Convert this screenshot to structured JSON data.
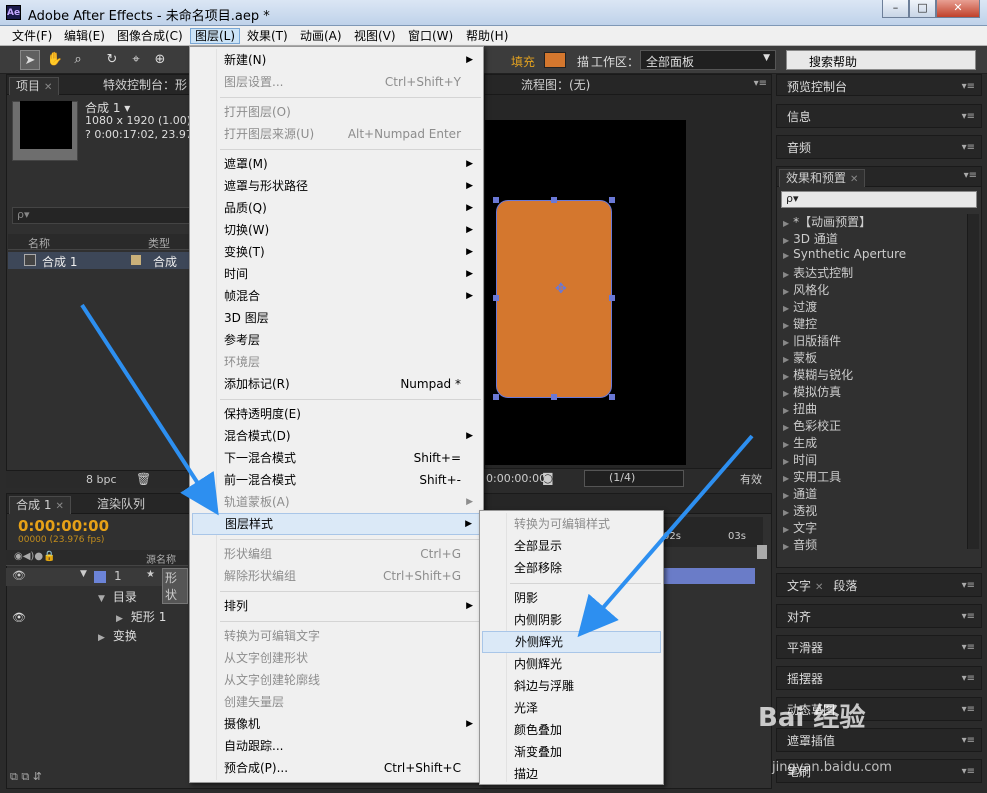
{
  "window": {
    "app_badge": "Ae",
    "title": "Adobe After Effects - 未命名项目.aep *",
    "min": "–",
    "max": "□",
    "close": "✕"
  },
  "menubar": [
    "文件(F)",
    "编辑(E)",
    "图像合成(C)",
    "图层(L)",
    "效果(T)",
    "动画(A)",
    "视图(V)",
    "窗口(W)",
    "帮助(H)"
  ],
  "toolbar": {
    "fill": "填充",
    "stroke": "描",
    "workspace_label": "工作区：",
    "workspace_value": "全部面板",
    "search_help": "搜索帮助"
  },
  "project_panel": {
    "tab": "项目",
    "tab2": "特效控制台：形",
    "comp_name": "合成 1 ▾",
    "comp_size": "1080 x 1920 (1.00)",
    "comp_dur": "? 0:00:17:02, 23.976",
    "search_placeholder": "ρ▾",
    "col_name": "名称",
    "col_type": "类型",
    "row_name": "合成 1",
    "row_type": "合成",
    "bpc": "8 bpc"
  },
  "viewer": {
    "flow_tab": "流程图：(无)",
    "timecode": "0:00:00:00",
    "res": "(1/4)",
    "active": "有效"
  },
  "layer_menu": [
    {
      "label": "新建(N)",
      "sub": true
    },
    {
      "label": "图层设置...",
      "sc": "Ctrl+Shift+Y",
      "dis": true
    },
    {
      "sep": true
    },
    {
      "label": "打开图层(O)",
      "dis": true
    },
    {
      "label": "打开图层来源(U)",
      "sc": "Alt+Numpad Enter",
      "dis": true
    },
    {
      "sep": true
    },
    {
      "label": "遮罩(M)",
      "sub": true
    },
    {
      "label": "遮罩与形状路径",
      "sub": true
    },
    {
      "label": "品质(Q)",
      "sub": true
    },
    {
      "label": "切换(W)",
      "sub": true
    },
    {
      "label": "变换(T)",
      "sub": true
    },
    {
      "label": "时间",
      "sub": true
    },
    {
      "label": "帧混合",
      "sub": true
    },
    {
      "label": "3D 图层"
    },
    {
      "label": "参考层"
    },
    {
      "label": "环境层",
      "dis": true
    },
    {
      "label": "添加标记(R)",
      "sc": "Numpad *"
    },
    {
      "sep": true
    },
    {
      "label": "保持透明度(E)"
    },
    {
      "label": "混合模式(D)",
      "sub": true
    },
    {
      "label": "下一混合模式",
      "sc": "Shift+="
    },
    {
      "label": "前一混合模式",
      "sc": "Shift+-"
    },
    {
      "label": "轨道蒙板(A)",
      "sub": true,
      "dis": true
    },
    {
      "label": "图层样式",
      "sub": true,
      "hl": true
    },
    {
      "sep": true
    },
    {
      "label": "形状编组",
      "sc": "Ctrl+G",
      "dis": true
    },
    {
      "label": "解除形状编组",
      "sc": "Ctrl+Shift+G",
      "dis": true
    },
    {
      "sep": true
    },
    {
      "label": "排列",
      "sub": true
    },
    {
      "sep": true
    },
    {
      "label": "转换为可编辑文字",
      "dis": true
    },
    {
      "label": "从文字创建形状",
      "dis": true
    },
    {
      "label": "从文字创建轮廓线",
      "dis": true
    },
    {
      "label": "创建矢量层",
      "dis": true
    },
    {
      "label": "摄像机",
      "sub": true
    },
    {
      "label": "自动跟踪..."
    },
    {
      "label": "预合成(P)...",
      "sc": "Ctrl+Shift+C"
    }
  ],
  "style_menu": [
    {
      "label": "转换为可编辑样式",
      "dis": true
    },
    {
      "label": "全部显示"
    },
    {
      "label": "全部移除"
    },
    {
      "sep": true
    },
    {
      "label": "阴影"
    },
    {
      "label": "内侧阴影"
    },
    {
      "label": "外侧辉光",
      "hl": true
    },
    {
      "label": "内侧辉光"
    },
    {
      "label": "斜边与浮雕"
    },
    {
      "label": "光泽"
    },
    {
      "label": "颜色叠加"
    },
    {
      "label": "渐变叠加"
    },
    {
      "label": "描边"
    }
  ],
  "right_panels": {
    "preview": "预览控制台",
    "info": "信息",
    "audio": "音频",
    "effects": "效果和预置",
    "text": "文字",
    "paragraph": "段落",
    "align": "对齐",
    "smoother": "平滑器",
    "wiggler": "摇摆器",
    "motion": "动态草图",
    "mask": "遮罩插值",
    "brush": "笔刷"
  },
  "effects_list": [
    "*【动画预置】",
    "3D 通道",
    "Synthetic Aperture",
    "表达式控制",
    "风格化",
    "过渡",
    "键控",
    "旧版插件",
    "蒙板",
    "模糊与锐化",
    "模拟仿真",
    "扭曲",
    "色彩校正",
    "生成",
    "时间",
    "实用工具",
    "通道",
    "透视",
    "文字",
    "音频"
  ],
  "timeline": {
    "tab": "合成 1",
    "tab2": "渲染队列",
    "time": "0:00:00:00",
    "fps": "00000 (23.976 fps)",
    "col_source": "源名称",
    "layer_num": "1",
    "layer_name": "形状",
    "row_contents": "目录",
    "row_rect": "矩形 1",
    "row_transform": "变换",
    "ruler_2s": "02s",
    "ruler_3s": "03s"
  },
  "watermark": {
    "text": "Bai 经验",
    "url": "jingyan.baidu.com"
  },
  "colors": {
    "fill": "#d4772e",
    "arrow": "#2d8ff0",
    "accent": "#e6a117"
  }
}
